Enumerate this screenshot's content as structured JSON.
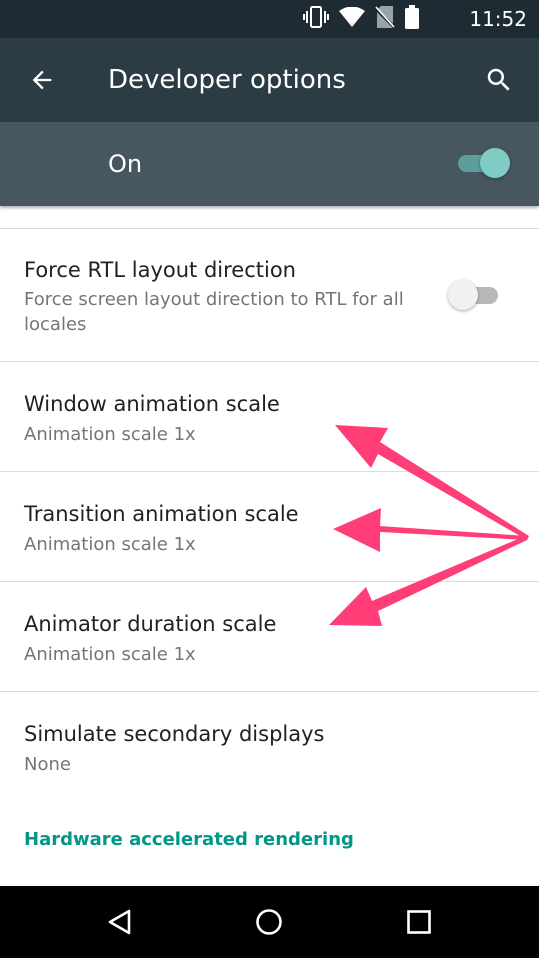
{
  "status_bar": {
    "time": "11:52",
    "icons": [
      "vibrate-icon",
      "wifi-icon",
      "no-sim-icon",
      "battery-icon"
    ]
  },
  "app_bar": {
    "title": "Developer options",
    "back_icon": "arrow-back-icon",
    "search_icon": "search-icon"
  },
  "master_switch": {
    "label": "On",
    "checked": true
  },
  "preferences": [
    {
      "title": "Force RTL layout direction",
      "summary": "Force screen layout direction to RTL for all\nlocales",
      "checked": false
    },
    {
      "title": "Window animation scale",
      "summary": "Animation scale 1x"
    },
    {
      "title": "Transition animation scale",
      "summary": "Animation scale 1x"
    },
    {
      "title": "Animator duration scale",
      "summary": "Animation scale 1x"
    },
    {
      "title": "Simulate secondary displays",
      "summary": "None"
    }
  ],
  "category_header": "Hardware accelerated rendering",
  "colors": {
    "status_bar": "#1f2b32",
    "app_bar": "#2c3c45",
    "master_bar": "#46575f",
    "accent": "#009688",
    "switch_on": "#80cbc4",
    "annotation_arrow": "#ff3d77"
  },
  "nav_bar": {
    "buttons": [
      "back-triangle-icon",
      "home-circle-icon",
      "recents-square-icon"
    ]
  }
}
